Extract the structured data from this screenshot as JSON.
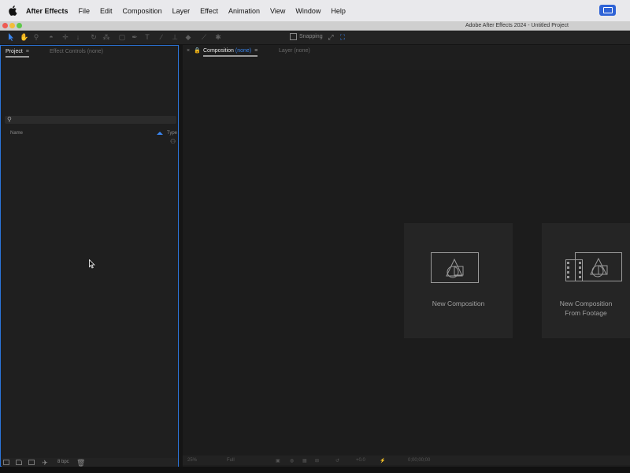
{
  "menubar": {
    "items": [
      "After Effects",
      "File",
      "Edit",
      "Composition",
      "Layer",
      "Effect",
      "Animation",
      "View",
      "Window",
      "Help"
    ]
  },
  "window": {
    "title": "Adobe After Effects 2024 - Untitled Project"
  },
  "toolbar": {
    "snapping_label": "Snapping"
  },
  "project_panel": {
    "tab_project": "Project",
    "tab_effect_controls": "Effect Controls (none)",
    "col_name": "Name",
    "col_type": "Type",
    "bpc": "8 bpc"
  },
  "comp_panel": {
    "tab_composition": "Composition",
    "tab_composition_none": "(none)",
    "tab_layer": "Layer (none)",
    "new_composition": "New Composition",
    "new_from_footage_line1": "New Composition",
    "new_from_footage_line2": "From Footage",
    "footer_zoom": "25%",
    "footer_res": "Full",
    "footer_exposure": "+0.0",
    "footer_time": "0;00;00;00"
  },
  "colors": {
    "accent": "#2b74d9",
    "menubar_bg": "#e9e9ec",
    "panel_bg": "#1f1f1f"
  },
  "icons": [
    "apple-icon",
    "control-center-icon",
    "selection-tool-icon",
    "hand-tool-icon",
    "zoom-tool-icon",
    "search-icon",
    "sort-arrow-icon",
    "flowchart-icon",
    "cursor-icon"
  ]
}
